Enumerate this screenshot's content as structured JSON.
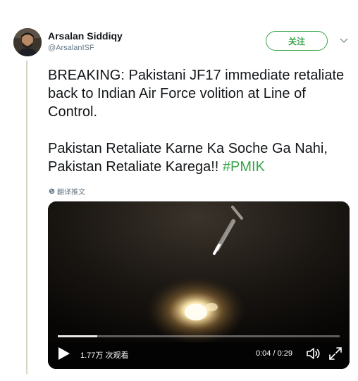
{
  "author": {
    "name": "Arsalan Siddiqy",
    "handle": "@ArsalanISF",
    "avatar_icon": "profile-photo"
  },
  "follow_button": {
    "label": "关注"
  },
  "menu": {
    "icon": "chevron-down-icon"
  },
  "tweet": {
    "paragraph1": "BREAKING: Pakistani JF17 immediate retaliate back to Indian Air Force volition at Line of Control.",
    "paragraph2_text": "Pakistan Retaliate Karne Ka Soche Ga Nahi, Pakistan Retaliate Karega!! ",
    "hashtag": "#PMIK",
    "translate_label": "翻译推文"
  },
  "video": {
    "views": "1.77万 次观看",
    "time": "0:04 / 0:29",
    "progress": 0.14
  },
  "colors": {
    "accent": "#3aa54a",
    "text": "#14171a",
    "muted": "#657786",
    "thread_line": "#cfd9c4"
  }
}
